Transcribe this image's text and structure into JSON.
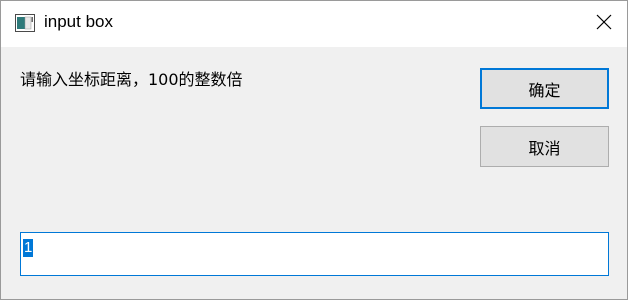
{
  "window": {
    "title": "input box",
    "close_glyph": "✕"
  },
  "dialog": {
    "prompt": "请输入坐标距离，100的整数倍",
    "ok_label": "确定",
    "cancel_label": "取消"
  },
  "input": {
    "value": "1",
    "selected": true
  },
  "colors": {
    "accent": "#0078d7",
    "dialog_bg": "#f0f0f0",
    "button_bg": "#e1e1e1"
  }
}
